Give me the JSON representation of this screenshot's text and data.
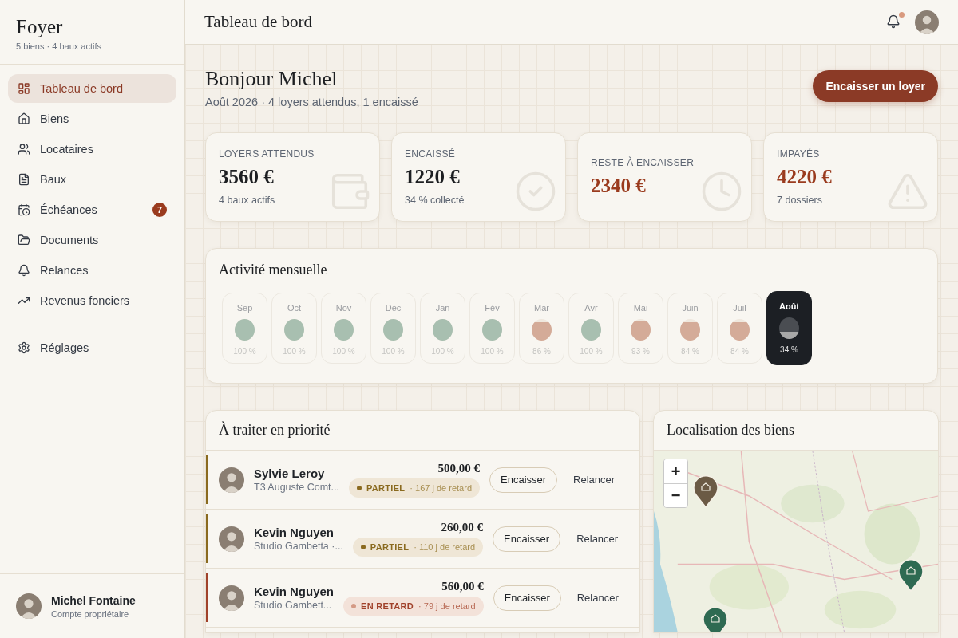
{
  "sidebar": {
    "brand": "Foyer",
    "subtitle": "5 biens · 4 baux actifs",
    "items": [
      {
        "label": "Tableau de bord",
        "selected": true
      },
      {
        "label": "Biens",
        "selected": false
      },
      {
        "label": "Locataires",
        "selected": false
      },
      {
        "label": "Baux",
        "selected": false
      },
      {
        "label": "Échéances",
        "selected": false,
        "badge": "7"
      },
      {
        "label": "Documents",
        "selected": false
      },
      {
        "label": "Relances",
        "selected": false
      },
      {
        "label": "Revenus fonciers",
        "selected": false
      }
    ],
    "settings": {
      "label": "Réglages",
      "selected": false
    },
    "user": {
      "name": "Michel Fontaine",
      "role": "Compte propriétaire"
    }
  },
  "header": {
    "title": "Tableau de bord",
    "notification_dot": true
  },
  "greeting": {
    "title": "Bonjour Michel",
    "subtitle": "Août 2026 · 4 loyers attendus, 1 encaissé",
    "action": "Encaisser un loyer"
  },
  "stats": [
    {
      "kind": "expected",
      "label": "LOYERS ATTENDUS",
      "value": "3560 €",
      "note": "4 baux actifs"
    },
    {
      "kind": "collected",
      "label": "ENCAISSÉ",
      "value": "1220 €",
      "note": "34 % collecté"
    },
    {
      "kind": "remaining",
      "label": "RESTE À ENCAISSER",
      "value": "2340 €"
    },
    {
      "kind": "overdue",
      "label": "IMPAYÉS",
      "value": "4220 €",
      "note": "7 dossiers"
    }
  ],
  "activity": {
    "title": "Activité mensuelle",
    "months": [
      {
        "label": "Sep",
        "percent": "100 %",
        "level": 1,
        "color": "#a8bfb0",
        "selected": false
      },
      {
        "label": "Oct",
        "percent": "100 %",
        "level": 1,
        "color": "#a8bfb0",
        "selected": false
      },
      {
        "label": "Nov",
        "percent": "100 %",
        "level": 1,
        "color": "#a8bfb0",
        "selected": false
      },
      {
        "label": "Déc",
        "percent": "100 %",
        "level": 1,
        "color": "#a8bfb0",
        "selected": false
      },
      {
        "label": "Jan",
        "percent": "100 %",
        "level": 1,
        "color": "#a8bfb0",
        "selected": false
      },
      {
        "label": "Fév",
        "percent": "100 %",
        "level": 1,
        "color": "#a8bfb0",
        "selected": false
      },
      {
        "label": "Mar",
        "percent": "86 %",
        "level": 0.86,
        "color": "#d4ab98",
        "selected": false
      },
      {
        "label": "Avr",
        "percent": "100 %",
        "level": 1,
        "color": "#a8bfb0",
        "selected": false
      },
      {
        "label": "Mai",
        "percent": "93 %",
        "level": 0.93,
        "color": "#d4ab98",
        "selected": false
      },
      {
        "label": "Juin",
        "percent": "84 %",
        "level": 0.84,
        "color": "#d4ab98",
        "selected": false
      },
      {
        "label": "Juil",
        "percent": "84 %",
        "level": 0.84,
        "color": "#d4ab98",
        "selected": false
      },
      {
        "label": "Août",
        "percent": "34 %",
        "level": 0.34,
        "color": "#a8a8a8",
        "selected": true
      }
    ]
  },
  "priority": {
    "title": "À traiter en priorité",
    "rows": [
      {
        "name": "Sylvie Leroy",
        "property": "T3 Auguste Comt...",
        "amount": "500,00 €",
        "status": {
          "kind": "partial",
          "label": "PARTIEL"
        },
        "delay": "· 167 j de retard",
        "color": "#8a6a1f",
        "actions": [
          "Encaisser",
          "Relancer"
        ]
      },
      {
        "name": "Kevin Nguyen",
        "property": "Studio Gambetta ·...",
        "amount": "260,00 €",
        "status": {
          "kind": "partial",
          "label": "PARTIEL"
        },
        "delay": "· 110 j de retard",
        "color": "#8a6a1f",
        "actions": [
          "Encaisser",
          "Relancer"
        ]
      },
      {
        "name": "Kevin Nguyen",
        "property": "Studio Gambett...",
        "amount": "560,00 €",
        "status": {
          "kind": "late",
          "label": "EN RETARD"
        },
        "delay": "· 79 j de retard",
        "color": "#a0412a",
        "actions": [
          "Encaisser",
          "Relancer"
        ]
      }
    ]
  },
  "map": {
    "title": "Localisation des biens",
    "zoom_in": "+",
    "zoom_out": "−",
    "markers": [
      {
        "color": "#6b5a45"
      },
      {
        "color": "#2e6a52"
      },
      {
        "color": "#2e6a52"
      }
    ]
  }
}
